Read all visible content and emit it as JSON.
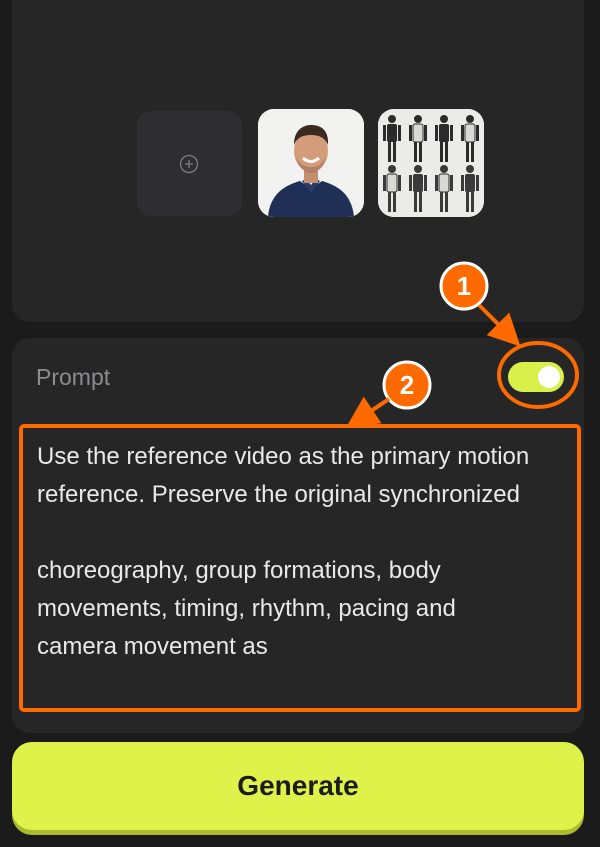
{
  "media": {
    "add_icon": "plus-circle-icon",
    "thumbnails": [
      {
        "name": "person-reference-image"
      },
      {
        "name": "robot-poses-reference-image"
      }
    ]
  },
  "prompt": {
    "label": "Prompt",
    "toggle_on": true,
    "text": "Use the reference video as the primary motion reference. Preserve the original synchronized\n\nchoreography, group formations, body movements, timing, rhythm, pacing and camera movement as"
  },
  "generate": {
    "label": "Generate"
  },
  "annotations": [
    {
      "number": "1"
    },
    {
      "number": "2"
    }
  ],
  "colors": {
    "accent": "#dff24a",
    "annotation": "#ff6a00",
    "panel": "#262627",
    "background": "#1b1b1c"
  }
}
